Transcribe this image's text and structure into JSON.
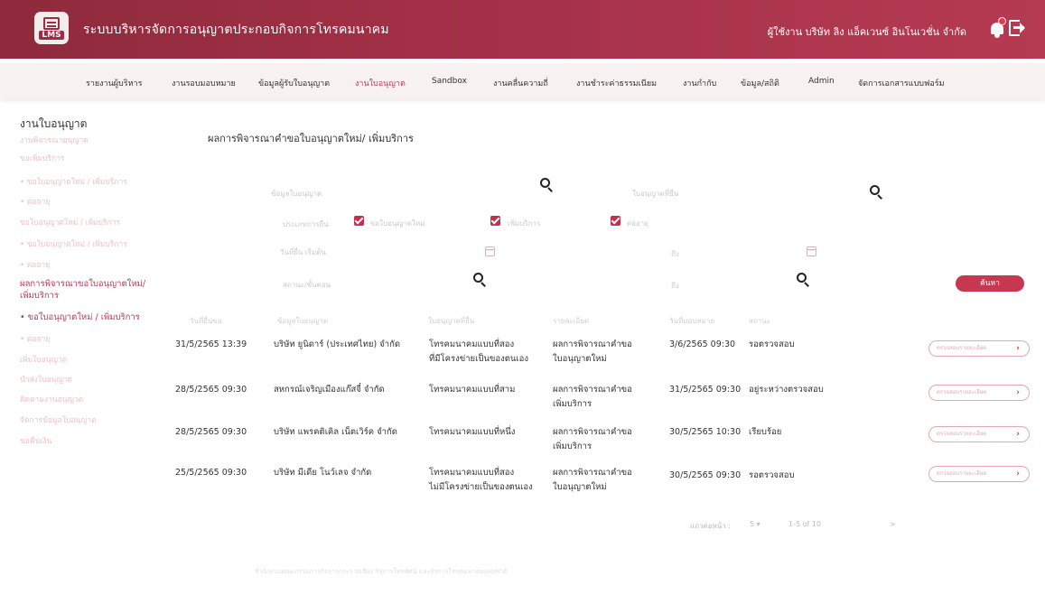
{
  "header": {
    "logo_text": "LMS",
    "app_title": "ระบบบริหารจัดการอนุญาตประกอบกิจการโทรคมนาคม",
    "user_text": "ผู้ใช้งาน บริษัท ลิง แอ็คเวนซ์ อินโนเวชั่น จำกัด",
    "bell_icon": "bell-icon",
    "logout_icon": "logout-icon"
  },
  "nav": {
    "items": [
      "รายงานผู้บริหาร",
      "งานรอบมอบหมาย",
      "ข้อมูลผู้รับใบอนุญาต",
      "งานใบอนุญาต",
      "Sandbox",
      "งานคลื่นความถี่",
      "งานชำระค่าธรรมเนียม",
      "งานกำกับ",
      "ข้อมูล/สถิติ",
      "Admin",
      "จัดการเอกสารแบบฟอร์ม"
    ],
    "active_index": 3
  },
  "sidebar": {
    "title": "งานใบอนุญาต",
    "items": [
      "งานพิจารณาอนุญาต",
      "ขอเพิ่มบริการ",
      "• ขอใบอนุญาตใหม่ / เพิ่มบริการ",
      "• ต่ออายุ",
      "ขอใบอนุญาตใหม่ / เพิ่มบริการ",
      "• ขอใบอนุญาตใหม่ / เพิ่มบริการ",
      "• ต่ออายุ",
      "ผลการพิจารณาขอใบอนุญาตใหม่/",
      "เพิ่มบริการ",
      "• ขอใบอนุญาตใหม่ / เพิ่มบริการ",
      "• ต่ออายุ",
      "เพิ่มใบอนุญาต",
      "นำส่งใบอนุญาต",
      "ติดตามงานอนุญาต",
      "จัดการข้อมูลใบอนุญาต",
      "ขอคืนเงิน"
    ]
  },
  "main": {
    "title": "ผลการพิจารณาคำขอใบอนุญาตใหม่/ เพิ่มบริการ",
    "filters": {
      "licensee_label": "ข้อมูลใบอนุญาต",
      "license_type_label": "ใบอนุญาตที่ยื่น",
      "request_type_label": "ประเภทการยื่น",
      "start_date_label": "วันที่ยื่น เริ่มต้น",
      "to_label_1": "ถึง",
      "status_label": "สถานะ/ขั้นตอน",
      "to_label_2": "ถึง",
      "checkboxes": [
        "ขอใบอนุญาตใหม่",
        "เพิ่มบริการ",
        "ต่ออายุ"
      ],
      "search_button": "ค้นหา"
    },
    "table": {
      "headers": [
        "วันที่ยื่นขอ",
        "ข้อมูลใบอนุญาต",
        "ใบอนุญาตที่ยื่น",
        "รายละเอียด",
        "วันที่มอบหมาย",
        "สถานะ"
      ],
      "rows": [
        {
          "date": "31/5/2565 13:39",
          "licensee": "บริษัท ยูนิดาร์ (ประเทศไทย) จำกัด",
          "type1": "โทรคมนาคมแบบที่สอง",
          "type2": "ที่มีโครงข่ายเป็นของตนเอง",
          "detail1": "ผลการพิจารณาคำขอ",
          "detail2": "ใบอนุญาตใหม่",
          "assigned": "3/6/2565 09:30",
          "status": "รอตรวจสอบ",
          "action": "ตรวจสอบรายละเอียด"
        },
        {
          "date": "28/5/2565 09:30",
          "licensee": "สหกรณ์เจริญเมืองแก๊สจี๋ จำกัด",
          "type1": "โทรคมนาคมแบบที่สาม",
          "type2": "",
          "detail1": "ผลการพิจารณาคำขอ",
          "detail2": "เพิ่มบริการ",
          "assigned": "31/5/2565 09:30",
          "status": "อยู่ระหว่างตรวจสอบ",
          "action": "ตรวจสอบรายละเอียด"
        },
        {
          "date": "28/5/2565 09:30",
          "licensee": "บริษัท แพรคติเคิล เน็ตเวิร์ค จำกัด",
          "type1": "โทรคมนาคมแบบที่หนึ่ง",
          "type2": "",
          "detail1": "ผลการพิจารณาคำขอ",
          "detail2": "เพิ่มบริการ",
          "assigned": "30/5/2565 10:30",
          "status": "เรียบร้อย",
          "action": "ตรวจสอบรายละเอียด"
        },
        {
          "date": "25/5/2565 09:30",
          "licensee": "บริษัท มีเดีย โนว์เลจ จำกัด",
          "type1": "โทรคมนาคมแบบที่สอง",
          "type2": "ไม่มีโครงข่ายเป็นของตนเอง",
          "detail1": "ผลการพิจารณาคำขอ",
          "detail2": "ใบอนุญาตใหม่",
          "assigned": "30/5/2565 09:30",
          "status": "รอตรวจสอบ",
          "action": "ตรวจสอบรายละเอียด"
        }
      ]
    },
    "pagination": {
      "rows_label": "แถวต่อหน้า :",
      "rows_value": "5 ▾",
      "range": "1-5 of 10",
      "next": ">"
    }
  },
  "footer": {
    "text": "สำนักงานคณะกรรมการกิจการกระจายเสียง กิจการโทรทัศน์ และกิจการโทรคมนาคมแห่งชาติ"
  }
}
